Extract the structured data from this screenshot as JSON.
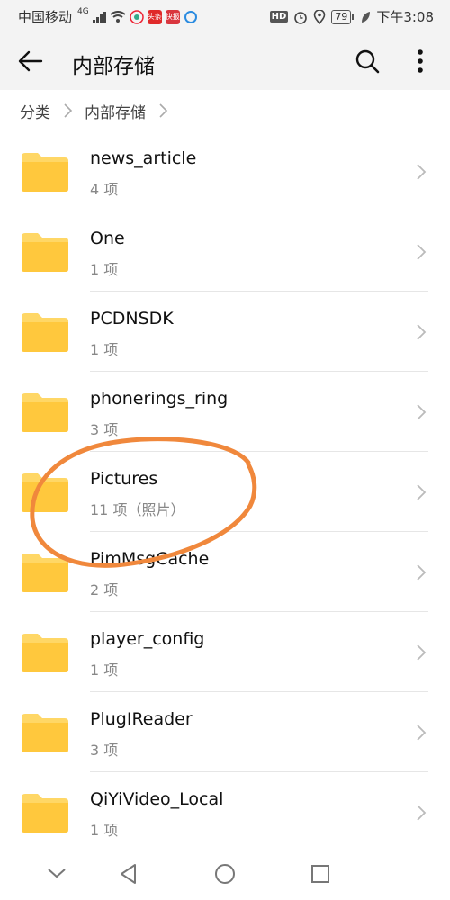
{
  "status_bar": {
    "carrier": "中国移动",
    "network": "4G",
    "app_badges": [
      "头条",
      "快报"
    ],
    "hd_label": "HD",
    "battery": "79",
    "time": "下午3:08"
  },
  "app_bar": {
    "title": "内部存储",
    "icons": [
      "back-arrow-icon",
      "search-icon",
      "more-vert-icon"
    ]
  },
  "breadcrumb": {
    "items": [
      "分类",
      "内部存储"
    ]
  },
  "folders": [
    {
      "name": "news_article",
      "meta": "4 项"
    },
    {
      "name": "One",
      "meta": "1 项"
    },
    {
      "name": "PCDNSDK",
      "meta": "1 项"
    },
    {
      "name": "phonerings_ring",
      "meta": "3 项"
    },
    {
      "name": "Pictures",
      "meta": "11 项（照片）"
    },
    {
      "name": "PimMsgCache",
      "meta": "2 项"
    },
    {
      "name": "player_config",
      "meta": "1 项"
    },
    {
      "name": "PlugIReader",
      "meta": "3 项"
    },
    {
      "name": "QiYiVideo_Local",
      "meta": "1 项"
    }
  ],
  "colors": {
    "folder": "#FFC83D",
    "folder_tab": "#FFD766",
    "annotation": "#F0883C",
    "bar_bg": "#F3F3F3"
  },
  "nav_bar": {
    "icons": [
      "collapse-chevron-icon",
      "back-triangle-icon",
      "home-circle-icon",
      "recents-square-icon"
    ]
  }
}
